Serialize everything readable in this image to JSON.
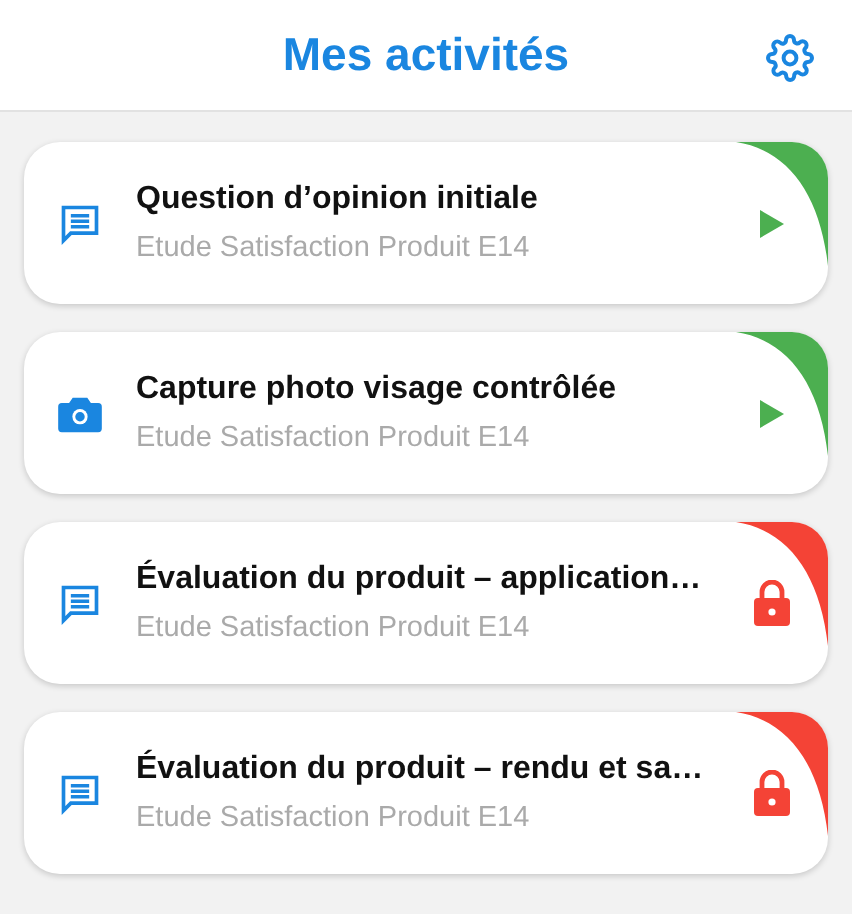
{
  "header": {
    "title": "Mes activités"
  },
  "activities": [
    {
      "kind": "question",
      "title": "Question d’opinion initiale",
      "subtitle": "Etude Satisfaction Produit E14",
      "locked": false,
      "color": "#4caf50"
    },
    {
      "kind": "photo",
      "title": "Capture photo visage contrôlée",
      "subtitle": "Etude Satisfaction Produit E14",
      "locked": false,
      "color": "#4caf50"
    },
    {
      "kind": "question",
      "title": "Évaluation du produit – application…",
      "subtitle": "Etude Satisfaction Produit E14",
      "locked": true,
      "color": "#f44336"
    },
    {
      "kind": "question",
      "title": "Évaluation du produit – rendu et sa…",
      "subtitle": "Etude Satisfaction Produit E14",
      "locked": true,
      "color": "#f44336"
    }
  ]
}
